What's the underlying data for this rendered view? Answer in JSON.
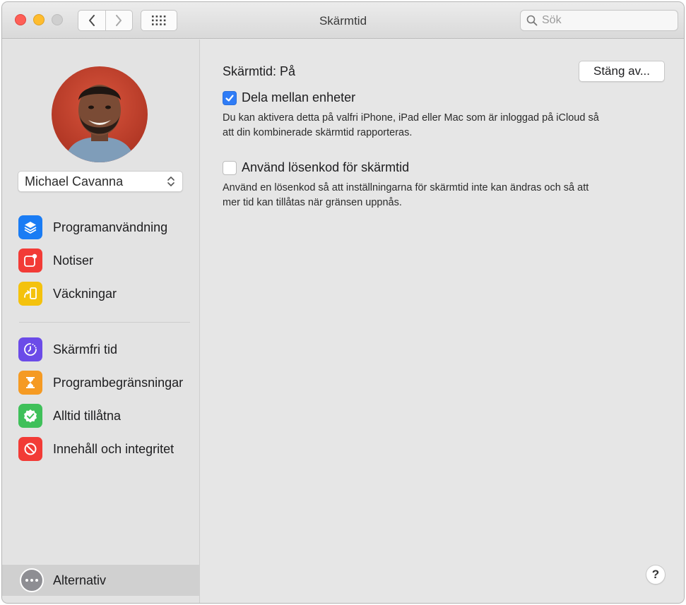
{
  "window": {
    "title": "Skärmtid",
    "search_placeholder": "Sök"
  },
  "toolbar": {
    "back_icon": "chevron-left-icon",
    "forward_icon": "chevron-right-icon",
    "grid_icon": "show-all-grid-icon"
  },
  "sidebar": {
    "user_name": "Michael Cavanna",
    "group1": [
      {
        "label": "Programanvändning",
        "icon": "layers-icon",
        "color": "#1a7cf4"
      },
      {
        "label": "Notiser",
        "icon": "notification-badge-icon",
        "color": "#f23b36"
      },
      {
        "label": "Väckningar",
        "icon": "pickup-phone-icon",
        "color": "#f4c20d"
      }
    ],
    "group2": [
      {
        "label": "Skärmfri tid",
        "icon": "downtime-clock-icon",
        "color": "#6b4be8"
      },
      {
        "label": "Programbegränsningar",
        "icon": "hourglass-icon",
        "color": "#f59a23"
      },
      {
        "label": "Alltid tillåtna",
        "icon": "checkmark-badge-icon",
        "color": "#3fc05a"
      },
      {
        "label": "Innehåll och integritet",
        "icon": "restriction-icon",
        "color": "#f23b36"
      }
    ],
    "options_label": "Alternativ"
  },
  "main": {
    "status_label": "Skärmtid: På",
    "turn_off_button": "Stäng av...",
    "share_label": "Dela mellan enheter",
    "share_checked": true,
    "share_desc_line1": "Du kan aktivera detta på valfri iPhone, iPad eller Mac som är inloggad på iCloud så",
    "share_desc_line2": "att din kombinerade skärmtid rapporteras.",
    "passcode_label": "Använd lösenkod för skärmtid",
    "passcode_checked": false,
    "passcode_desc_line1": "Använd en lösenkod så att inställningarna för skärmtid inte kan ändras och så att",
    "passcode_desc_line2": "mer tid kan tillåtas när gränsen uppnås.",
    "help_label": "?"
  }
}
